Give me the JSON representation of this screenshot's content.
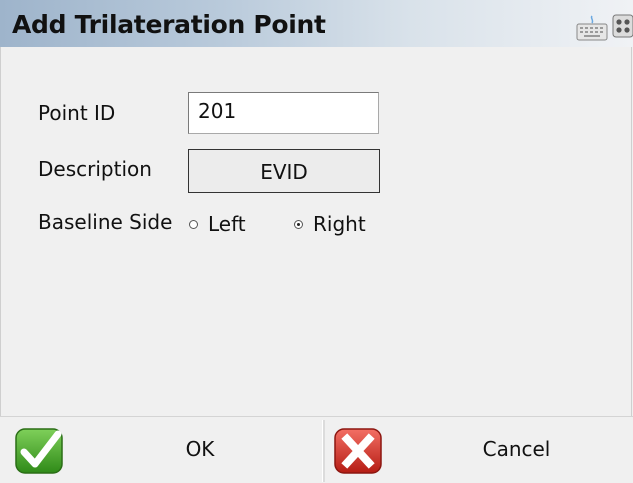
{
  "window": {
    "title": "Add Trilateration Point"
  },
  "icons": {
    "keyboard": "keyboard-icon",
    "calculator": "calculator-icon",
    "ok": "checkmark-icon",
    "cancel": "x-icon"
  },
  "form": {
    "point_id": {
      "label": "Point ID",
      "value": "201"
    },
    "description": {
      "label": "Description",
      "value": "EVID"
    },
    "baseline_side": {
      "label": "Baseline Side",
      "options": [
        {
          "label": "Left",
          "selected": false
        },
        {
          "label": "Right",
          "selected": true
        }
      ]
    }
  },
  "actions": {
    "ok_label": "OK",
    "cancel_label": "Cancel"
  },
  "colors": {
    "ok_green": "#3a9a1f",
    "cancel_red": "#c8291f"
  }
}
